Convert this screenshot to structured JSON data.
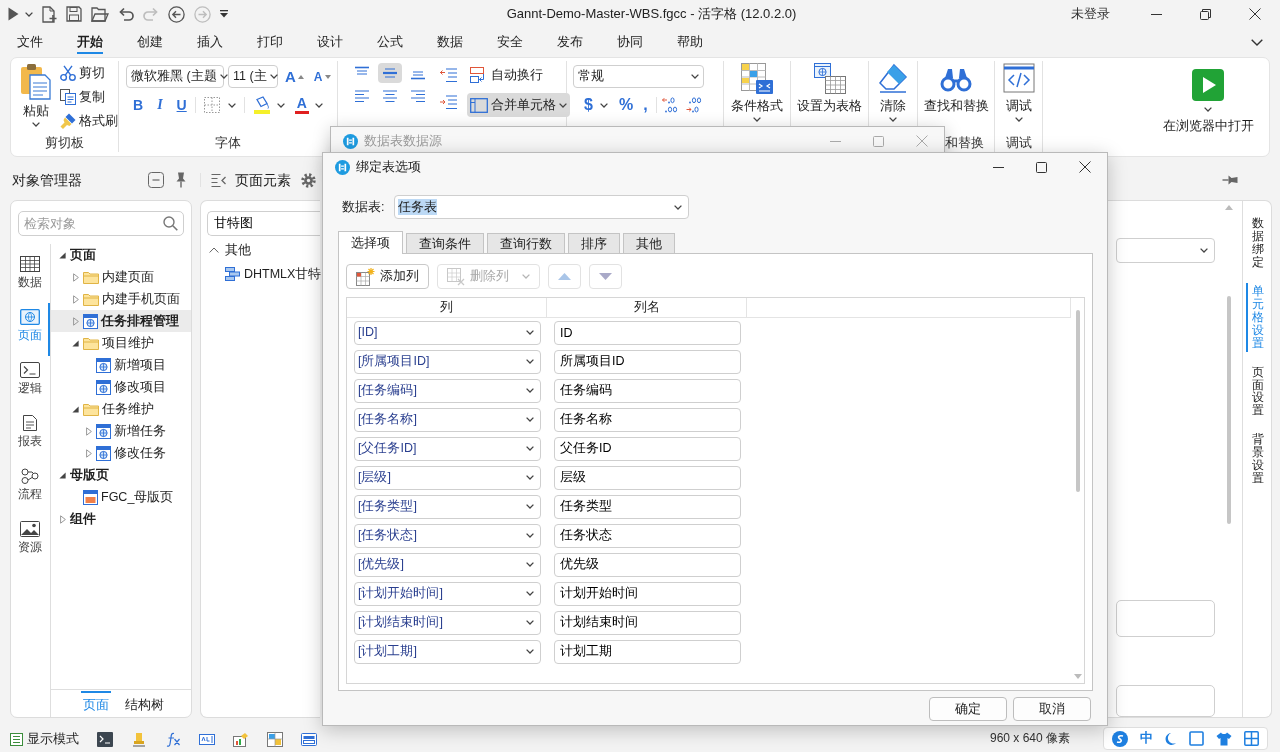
{
  "window": {
    "title": "Gannt-Demo-Master-WBS.fgcc - 活字格 (12.0.2.0)",
    "account": "未登录"
  },
  "quick_access": [
    {
      "kind": "run",
      "disabled": false
    },
    {
      "kind": "new",
      "disabled": false
    },
    {
      "kind": "save",
      "disabled": false
    },
    {
      "kind": "open",
      "disabled": false
    },
    {
      "kind": "undo",
      "disabled": false
    },
    {
      "kind": "redo",
      "disabled": true
    },
    {
      "kind": "back",
      "disabled": false
    },
    {
      "kind": "forward",
      "disabled": true
    }
  ],
  "menu_tabs": [
    {
      "label": "文件",
      "selected": false
    },
    {
      "label": "开始",
      "selected": true
    },
    {
      "label": "创建",
      "selected": false
    },
    {
      "label": "插入",
      "selected": false
    },
    {
      "label": "打印",
      "selected": false
    },
    {
      "label": "设计",
      "selected": false
    },
    {
      "label": "公式",
      "selected": false
    },
    {
      "label": "数据",
      "selected": false
    },
    {
      "label": "安全",
      "selected": false
    },
    {
      "label": "发布",
      "selected": false
    },
    {
      "label": "协同",
      "selected": false
    },
    {
      "label": "帮助",
      "selected": false
    }
  ],
  "ribbon": {
    "clipboard": {
      "paste": "粘贴",
      "cut": "剪切",
      "copy": "复制",
      "format_painter": "格式刷",
      "label": "剪切板"
    },
    "font": {
      "family": "微软雅黑 (主题",
      "size": "11 (主",
      "grow": "A",
      "shrink": "A",
      "bold": "B",
      "italic": "I",
      "underline": "U",
      "font_color_letter": "A",
      "label": "字体"
    },
    "alignment": {
      "vertical": [
        {
          "selected": false
        },
        {
          "selected": true
        },
        {
          "selected": false
        }
      ],
      "wrap_text": {
        "label": "自动换行",
        "selected": false
      },
      "merge_cells": {
        "label": "合并单元格",
        "selected": true
      }
    },
    "number": {
      "format": "常规",
      "currency": "$",
      "percent": "%",
      "comma": ","
    },
    "commands": [
      {
        "kind": "conditional_format",
        "label": "条件格式",
        "dropdown": true
      },
      {
        "kind": "format_as_table",
        "label": "设置为表格",
        "dropdown": false
      },
      {
        "kind": "clear",
        "label": "清除",
        "dropdown": true
      },
      {
        "kind": "find_replace",
        "label": "查找和替换",
        "dropdown": false,
        "group_label": "和替换"
      },
      {
        "kind": "debug",
        "label": "调试",
        "dropdown": true,
        "group_label": "调试"
      }
    ],
    "open_in_browser": {
      "label": "在浏览器中打开",
      "dropdown": true
    }
  },
  "object_manager": {
    "title": "对象管理器",
    "search_placeholder": "检索对象",
    "nav": [
      {
        "label": "数据",
        "selected": false
      },
      {
        "label": "页面",
        "selected": true
      },
      {
        "label": "逻辑",
        "selected": false
      },
      {
        "label": "报表",
        "selected": false
      },
      {
        "label": "流程",
        "selected": false
      },
      {
        "label": "资源",
        "selected": false
      }
    ],
    "tree": [
      {
        "label": "页面",
        "kind": "section",
        "expanded": true,
        "selected": false,
        "children": [
          {
            "label": "内建页面",
            "kind": "folder",
            "expanded": false,
            "selected": false
          },
          {
            "label": "内建手机页面",
            "kind": "folder",
            "expanded": false,
            "selected": false
          },
          {
            "label": "任务排程管理",
            "kind": "page",
            "expanded": false,
            "selected": true
          },
          {
            "label": "项目维护",
            "kind": "folder",
            "expanded": true,
            "selected": false,
            "children": [
              {
                "label": "新增项目",
                "kind": "page",
                "selected": false
              },
              {
                "label": "修改项目",
                "kind": "page",
                "selected": false
              }
            ]
          },
          {
            "label": "任务维护",
            "kind": "folder",
            "expanded": true,
            "selected": false,
            "children": [
              {
                "label": "新增任务",
                "kind": "page",
                "expanded": false,
                "selected": false
              },
              {
                "label": "修改任务",
                "kind": "page",
                "expanded": false,
                "selected": false
              }
            ]
          }
        ]
      },
      {
        "label": "母版页",
        "kind": "section",
        "expanded": true,
        "selected": false,
        "children": [
          {
            "label": "FGC_母版页",
            "kind": "master",
            "selected": false
          }
        ]
      },
      {
        "label": "组件",
        "kind": "section",
        "expanded": false,
        "selected": false
      }
    ],
    "bottom_tabs": [
      {
        "label": "页面",
        "selected": true
      },
      {
        "label": "结构树",
        "selected": false
      }
    ]
  },
  "page_elements": {
    "title": "页面元素",
    "filter": "甘特图",
    "groups": [
      {
        "label": "其他",
        "expanded": true,
        "items": [
          "DHTMLX甘特"
        ]
      }
    ]
  },
  "property_panel": {
    "tabs": [
      {
        "label": "数据绑定",
        "selected": false
      },
      {
        "label": "单元格设置",
        "selected": true
      },
      {
        "label": "页面设置",
        "selected": false
      },
      {
        "label": "背景设置",
        "selected": false
      }
    ]
  },
  "status_bar": {
    "display_mode": "显示模式",
    "canvas_size": "960 x 640 像素"
  },
  "ime_bar": {
    "mode": "中"
  },
  "background_dialog": {
    "title": "数据表数据源"
  },
  "dialog": {
    "title": "绑定表选项",
    "table_label": "数据表:",
    "table": "任务表",
    "table_text_selected": true,
    "tabs": [
      {
        "label": "选择项",
        "selected": true
      },
      {
        "label": "查询条件",
        "selected": false
      },
      {
        "label": "查询行数",
        "selected": false
      },
      {
        "label": "排序",
        "selected": false
      },
      {
        "label": "其他",
        "selected": false
      }
    ],
    "toolbar": [
      {
        "kind": "add",
        "label": "添加列",
        "disabled": false
      },
      {
        "kind": "delete",
        "label": "删除列",
        "disabled": true
      },
      {
        "kind": "move_up",
        "disabled": true
      },
      {
        "kind": "move_down",
        "disabled": true
      }
    ],
    "columns": [
      "列",
      "列名"
    ],
    "rows": [
      {
        "column": "[ID]",
        "name": "ID"
      },
      {
        "column": "[所属项目ID]",
        "name": "所属项目ID"
      },
      {
        "column": "[任务编码]",
        "name": "任务编码"
      },
      {
        "column": "[任务名称]",
        "name": "任务名称"
      },
      {
        "column": "[父任务ID]",
        "name": "父任务ID"
      },
      {
        "column": "[层级]",
        "name": "层级"
      },
      {
        "column": "[任务类型]",
        "name": "任务类型"
      },
      {
        "column": "[任务状态]",
        "name": "任务状态"
      },
      {
        "column": "[优先级]",
        "name": "优先级"
      },
      {
        "column": "[计划开始时间]",
        "name": "计划开始时间"
      },
      {
        "column": "[计划结束时间]",
        "name": "计划结束时间"
      },
      {
        "column": "[计划工期]",
        "name": "计划工期"
      }
    ],
    "buttons": [
      "确定",
      "取消"
    ]
  }
}
